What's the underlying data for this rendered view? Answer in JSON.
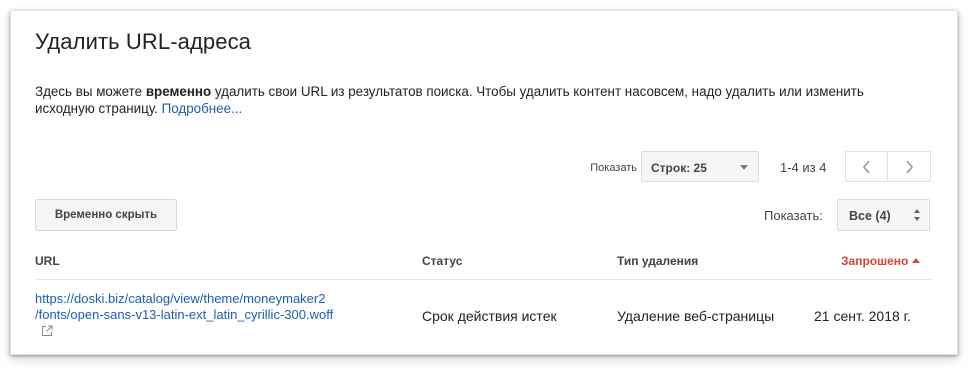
{
  "page": {
    "title": "Удалить URL-адреса",
    "description": {
      "part1": "Здесь вы можете ",
      "bold": "временно",
      "part2": " удалить свои URL из результатов поиска. Чтобы удалить контент насовсем, надо удалить или изменить исходную страницу. ",
      "more_link": "Подробнее..."
    }
  },
  "pager": {
    "show_label": "Показать",
    "rows_select": "Строк: 25",
    "range": "1-4 из 4",
    "prev_icon": "chevron-left-icon",
    "next_icon": "chevron-right-icon"
  },
  "toolbar": {
    "hide_button": "Временно скрыть",
    "filter_label": "Показать:",
    "filter_select": "Все (4)"
  },
  "table": {
    "headers": {
      "url": "URL",
      "status": "Статус",
      "type": "Тип удаления",
      "requested": "Запрошено"
    },
    "rows": [
      {
        "url_line1": "https://doski.biz/catalog/view/theme/moneymaker2",
        "url_line2": "/fonts/open-sans-v13-latin-ext_latin_cyrillic-300.woff",
        "status": "Срок действия истек",
        "type": "Удаление веб-страницы",
        "date": "21 сент. 2018 г."
      }
    ]
  },
  "colors": {
    "link": "#1a5fb4",
    "sort_active": "#d14836"
  }
}
